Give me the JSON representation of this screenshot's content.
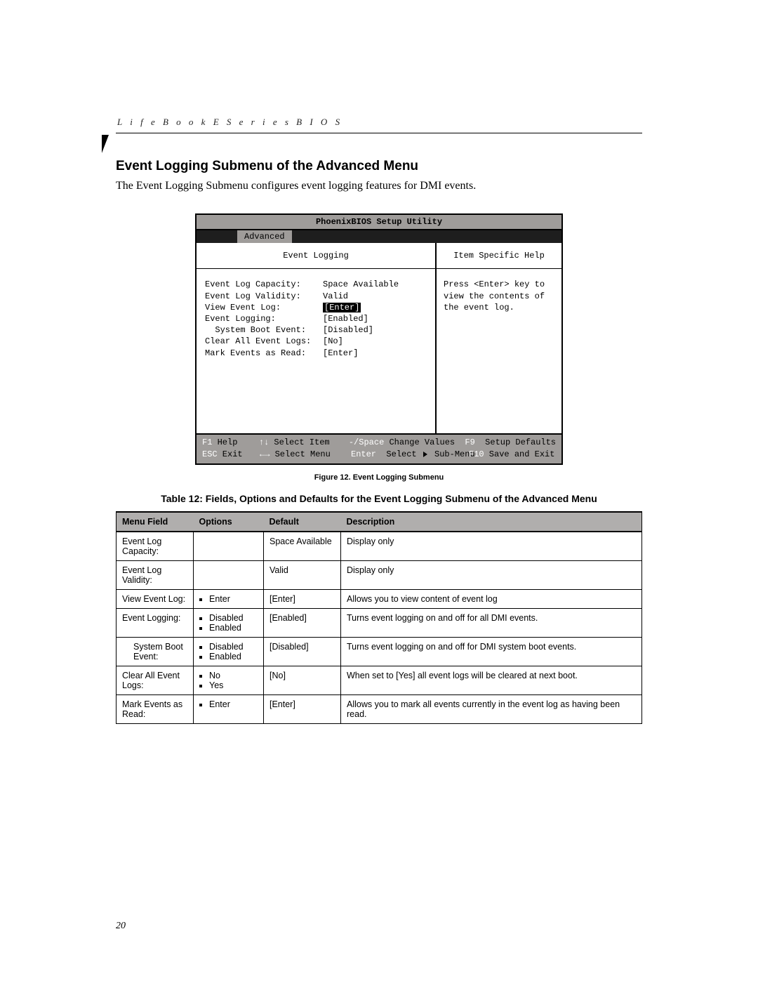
{
  "header": {
    "running": "L i f e B o o k   E   S e r i e s   B I O S"
  },
  "page_number": "20",
  "section": {
    "title": "Event Logging Submenu of the Advanced Menu",
    "intro": "The Event Logging Submenu configures event logging features for DMI events."
  },
  "bios": {
    "utility_title": "PhoenixBIOS Setup Utility",
    "active_tab": "Advanced",
    "left_title": "Event Logging",
    "right_title": "Item Specific Help",
    "help_text": "Press <Enter> key to view the contents of the event log.",
    "fields": [
      {
        "label": "Event Log Capacity:",
        "value": "Space Available"
      },
      {
        "label": "Event Log Validity:",
        "value": "Valid"
      },
      {
        "label": "",
        "value": ""
      },
      {
        "label": "View Event Log:",
        "value": "[Enter]",
        "highlight": true
      },
      {
        "label": "",
        "value": ""
      },
      {
        "label": "Event Logging:",
        "value": "[Enabled]"
      },
      {
        "label": "  System Boot Event:",
        "value": "[Disabled]"
      },
      {
        "label": "",
        "value": ""
      },
      {
        "label": "Clear All Event Logs:",
        "value": "[No]"
      },
      {
        "label": "",
        "value": ""
      },
      {
        "label": "Mark Events as Read:",
        "value": "[Enter]"
      }
    ],
    "footer": {
      "r1c1_k": "F1",
      "r1c1_t": " Help",
      "r1c2_k": "↑↓",
      "r1c2_t": " Select Item",
      "r1c3_k": "-/Space",
      "r1c3_t": " Change Values",
      "r1c4_k": "F9",
      "r1c4_t": "  Setup Defaults",
      "r2c1_k": "ESC",
      "r2c1_t": " Exit",
      "r2c2_k": "←→",
      "r2c2_t": " Select Menu",
      "r2c3_k": "Enter",
      "r2c3_t": "  Select ",
      "r2c3_t2": " Sub-Menu",
      "r2c4_k": "F10",
      "r2c4_t": " Save and Exit"
    }
  },
  "figcap": "Figure 12.  Event Logging Submenu",
  "tabcap": "Table 12: Fields, Options and Defaults for the Event Logging Submenu of the Advanced Menu",
  "table": {
    "headers": [
      "Menu Field",
      "Options",
      "Default",
      "Description"
    ],
    "rows": [
      {
        "menu": "Event Log Capacity:",
        "options": [],
        "default": "Space Available",
        "desc": "Display only"
      },
      {
        "menu": "Event Log Validity:",
        "options": [],
        "default": "Valid",
        "desc": "Display only"
      },
      {
        "menu": "View Event Log:",
        "options": [
          "Enter"
        ],
        "default": "[Enter]",
        "desc": "Allows you to view content of event log"
      },
      {
        "menu": "Event Logging:",
        "options": [
          "Disabled",
          "Enabled"
        ],
        "default": "[Enabled]",
        "desc": "Turns event logging on and off for all DMI events."
      },
      {
        "menu": "System Boot Event:",
        "indent": true,
        "options": [
          "Disabled",
          "Enabled"
        ],
        "default": "[Disabled]",
        "desc": "Turns event logging on and off for DMI system boot events."
      },
      {
        "menu": "Clear All Event Logs:",
        "options": [
          "No",
          "Yes"
        ],
        "default": "[No]",
        "desc": "When set to [Yes] all event logs will be cleared at next boot."
      },
      {
        "menu": "Mark Events as Read:",
        "options": [
          "Enter"
        ],
        "default": "[Enter]",
        "desc": "Allows you to mark all events currently in the event log as having been read."
      }
    ]
  }
}
